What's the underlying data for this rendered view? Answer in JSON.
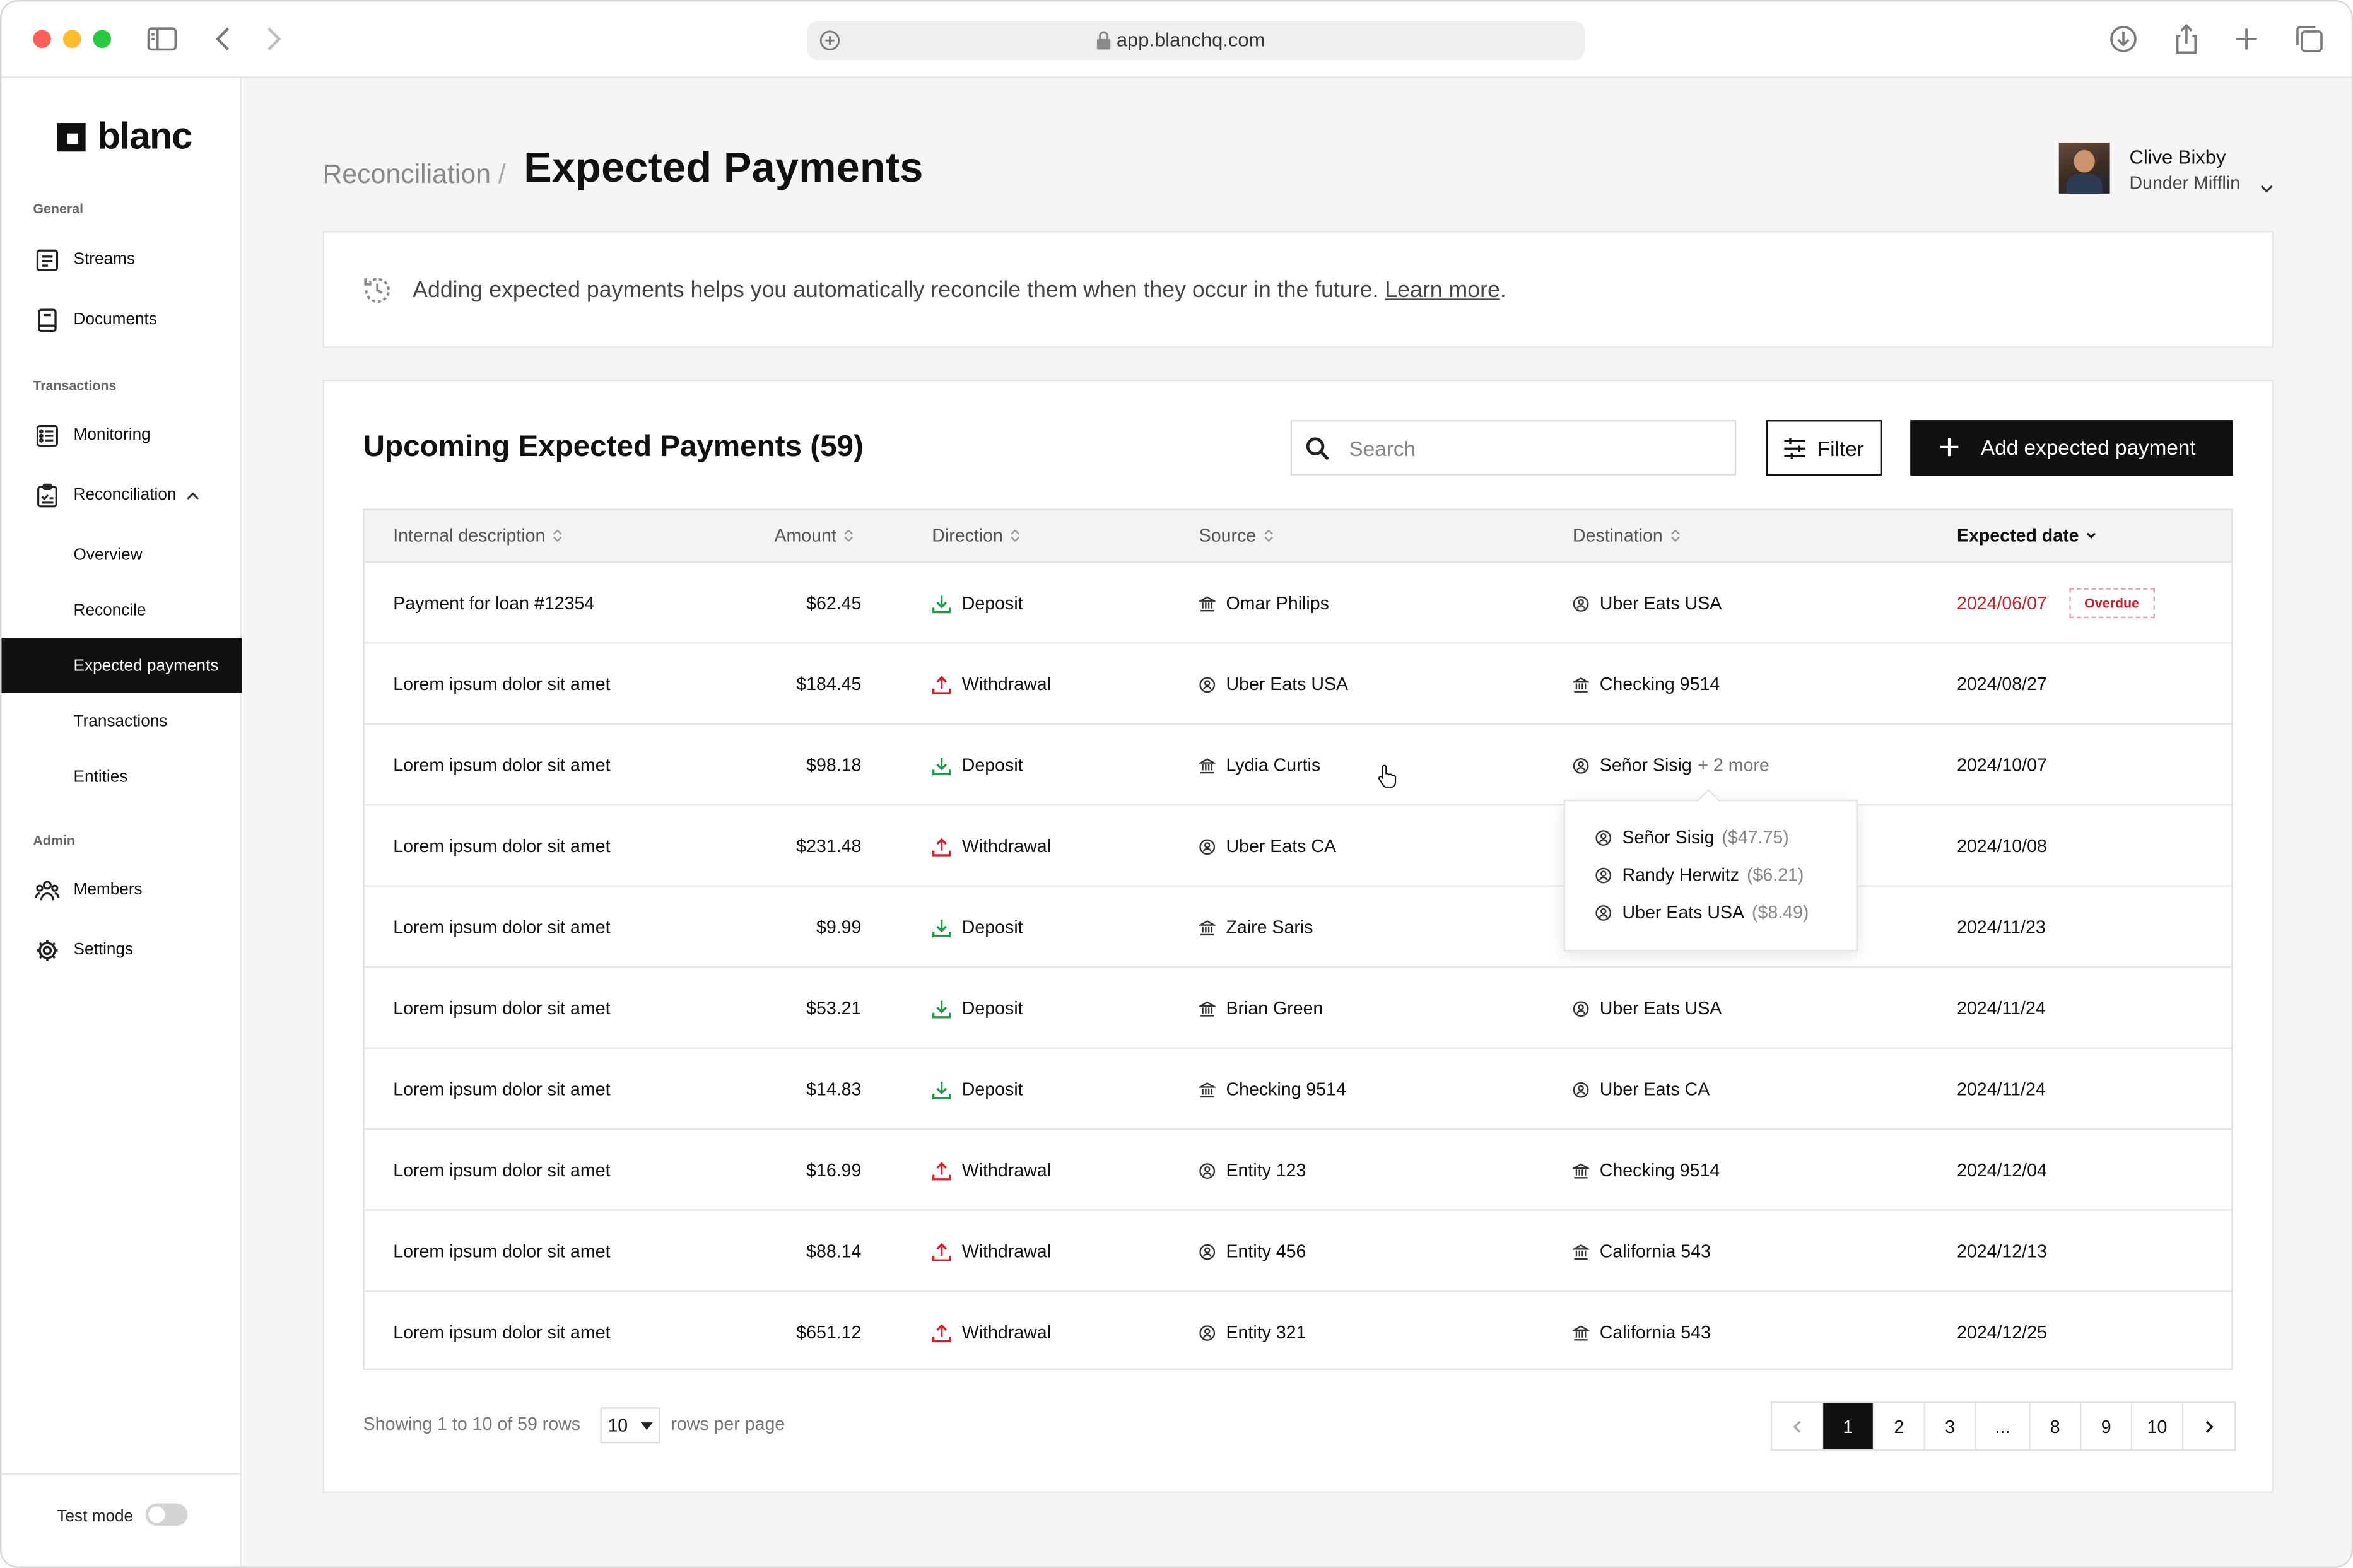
{
  "browser": {
    "url": "app.blanchq.com"
  },
  "brand": {
    "name": "blanc"
  },
  "sidebar": {
    "sections": {
      "general": "General",
      "transactions": "Transactions",
      "admin": "Admin"
    },
    "items": {
      "streams": "Streams",
      "documents": "Documents",
      "monitoring": "Monitoring",
      "reconciliation": "Reconciliation",
      "overview": "Overview",
      "reconcile": "Reconcile",
      "expected_payments": "Expected payments",
      "transactions": "Transactions",
      "entities": "Entities",
      "members": "Members",
      "settings": "Settings"
    },
    "test_mode": "Test mode"
  },
  "header": {
    "breadcrumb": "Reconciliation",
    "separator": "/",
    "title": "Expected Payments"
  },
  "user": {
    "name": "Clive Bixby",
    "org": "Dunder Mifflin"
  },
  "info": {
    "message": "Adding expected payments helps you automatically reconcile them when they occur in the future.",
    "link": "Learn more",
    "trailing": "."
  },
  "card": {
    "title": "Upcoming Expected Payments (59)",
    "search_placeholder": "Search",
    "filter_label": "Filter",
    "add_label": "Add expected payment"
  },
  "table": {
    "columns": [
      "Internal description",
      "Amount",
      "Direction",
      "Source",
      "Destination",
      "Expected date"
    ],
    "rows": [
      {
        "desc": "Payment for loan #12354",
        "amount": "$62.45",
        "direction": "Deposit",
        "source": "Omar Philips",
        "destination": "Uber Eats USA",
        "date": "2024/06/07",
        "badge": "Overdue"
      },
      {
        "desc": "Lorem ipsum dolor sit amet",
        "amount": "$184.45",
        "direction": "Withdrawal",
        "source": "Uber Eats USA",
        "destination": "Checking 9514",
        "date": "2024/08/27"
      },
      {
        "desc": "Lorem ipsum dolor sit amet",
        "amount": "$98.18",
        "direction": "Deposit",
        "source": "Lydia Curtis",
        "destination": "Señor Sisig",
        "destination_more": "+ 2 more",
        "date": "2024/10/07"
      },
      {
        "desc": "Lorem ipsum dolor sit amet",
        "amount": "$231.48",
        "direction": "Withdrawal",
        "source": "Uber Eats CA",
        "destination": "",
        "date": "2024/10/08"
      },
      {
        "desc": "Lorem ipsum dolor sit amet",
        "amount": "$9.99",
        "direction": "Deposit",
        "source": "Zaire Saris",
        "destination": "",
        "date": "2024/11/23"
      },
      {
        "desc": "Lorem ipsum dolor sit amet",
        "amount": "$53.21",
        "direction": "Deposit",
        "source": "Brian Green",
        "destination": "Uber Eats USA",
        "date": "2024/11/24"
      },
      {
        "desc": "Lorem ipsum dolor sit amet",
        "amount": "$14.83",
        "direction": "Deposit",
        "source": "Checking 9514",
        "destination": "Uber Eats CA",
        "date": "2024/11/24"
      },
      {
        "desc": "Lorem ipsum dolor sit amet",
        "amount": "$16.99",
        "direction": "Withdrawal",
        "source": "Entity 123",
        "destination": "Checking 9514",
        "date": "2024/12/04"
      },
      {
        "desc": "Lorem ipsum dolor sit amet",
        "amount": "$88.14",
        "direction": "Withdrawal",
        "source": "Entity 456",
        "destination": "California 543",
        "date": "2024/12/13"
      },
      {
        "desc": "Lorem ipsum dolor sit amet",
        "amount": "$651.12",
        "direction": "Withdrawal",
        "source": "Entity 321",
        "destination": "California 543",
        "date": "2024/12/25"
      }
    ]
  },
  "popover": {
    "items": [
      {
        "name": "Señor Sisig",
        "amount": "($47.75)"
      },
      {
        "name": "Randy Herwitz",
        "amount": "($6.21)"
      },
      {
        "name": "Uber Eats USA",
        "amount": "($8.49)"
      }
    ]
  },
  "footer": {
    "showing": "Showing 1 to 10 of 59 rows",
    "rows_value": "10",
    "rows_per_page": "rows per page",
    "pages": [
      "1",
      "2",
      "3",
      "...",
      "8",
      "9",
      "10"
    ]
  },
  "colors": {
    "accent": "#111111",
    "deposit": "#1f9b47",
    "withdrawal": "#d4202c",
    "overdue": "#c8202a"
  }
}
